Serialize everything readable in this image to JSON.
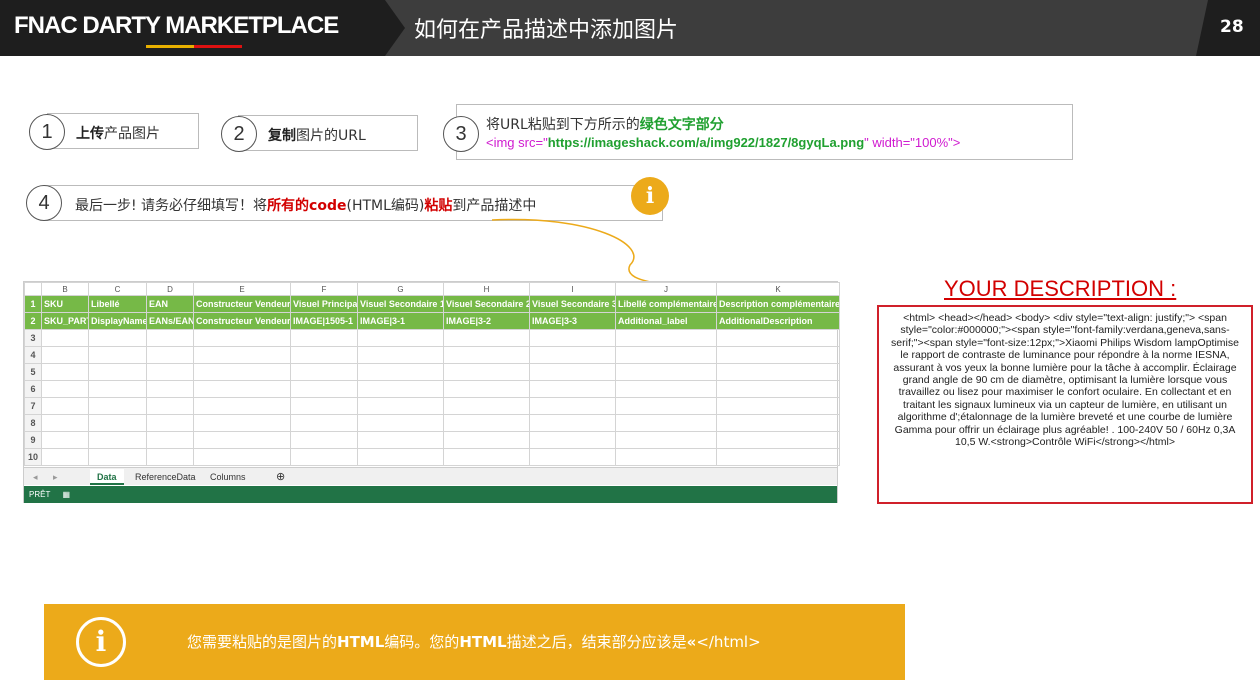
{
  "header": {
    "logo": "FNAC DARTY  MARKETPLACE",
    "title": "如何在产品描述中添加图片",
    "page_number": "28"
  },
  "steps": {
    "s1": {
      "num": "1",
      "bold": "上传",
      "rest": "产品图片"
    },
    "s2": {
      "num": "2",
      "bold": "复制",
      "rest": "图片的URL"
    },
    "s3": {
      "num": "3",
      "line1_a": "将",
      "line1_b": "URL",
      "line1_c": "粘贴到下方所示的",
      "line1_green": "绿色文字部分",
      "code_a": "<img src=\"",
      "code_url": "https://imageshack.com/a/img922/1827/8gyqLa.png",
      "code_b": "\" width=\"100%\">"
    },
    "s4": {
      "num": "4",
      "a": "最后一步! 请务必仔细填写！将",
      "red1": "所有的code",
      "b": "(HTML编码)",
      "red2": "粘贴",
      "c": "到产品描述中"
    }
  },
  "info_icon": "i",
  "sheet": {
    "col_letters": [
      "",
      "B",
      "C",
      "D",
      "E",
      "F",
      "G",
      "H",
      "I",
      "J",
      "K"
    ],
    "row1": [
      "1",
      "SKU",
      "Libellé",
      "EAN",
      "Constructeur Vendeur",
      "Visuel Principal",
      "Visuel Secondaire 1",
      "Visuel Secondaire 2",
      "Visuel Secondaire 3",
      "Libellé complémentaire",
      "Description complémentaire"
    ],
    "row2": [
      "2",
      "SKU_PART",
      "DisplayName",
      "EANs/EAN",
      "Constructeur Vendeur",
      "IMAGE|1505-1",
      "IMAGE|3-1",
      "IMAGE|3-2",
      "IMAGE|3-3",
      "Additional_label",
      "AdditionalDescription"
    ],
    "empty_rows": [
      "3",
      "4",
      "5",
      "6",
      "7",
      "8",
      "9",
      "10"
    ],
    "tabs": [
      "Data",
      "ReferenceData",
      "Columns"
    ],
    "add_tab": "⊕",
    "status": "PRÊT"
  },
  "description": {
    "title": "YOUR DESCRIPTION :",
    "text": "<html> <head></head> <body> <div style=\"text-align: justify;\"> <span style=\"color:#000000;\"><span style=\"font-family:verdana,geneva,sans-serif;\"><span style=\"font-size:12px;\">Xiaomi Philips Wisdom lampOptimise le rapport de contraste de luminance pour répondre à la norme IESNA, assurant à vos yeux la bonne lumière pour la tâche à accomplir. Éclairage grand angle de 90 cm de diamètre, optimisant la lumière lorsque vous travaillez ou lisez pour maximiser le confort oculaire. En collectant et en traitant les signaux lumineux via un capteur de lumière, en utilisant un algorithme d';étalonnage de la lumière breveté et une courbe de lumière Gamma pour offrir un éclairage plus agréable! . 100-240V 50 / 60Hz 0,3A 10,5 W.<strong>Contrôle WiFi</strong></html>"
  },
  "banner": {
    "icon": "i",
    "a": "您需要粘贴的是图片的",
    "b1": "HTML",
    "c": "编码。您的",
    "b2": "HTML",
    "d": "描述之后，结束部分应该是",
    "e": "«",
    "f": "</html>"
  },
  "colors": {
    "header_bg": "#3d3d3d",
    "accent_orange": "#ecaa1a",
    "excel_green": "#76b947",
    "status_green": "#217346",
    "red": "#d20000"
  }
}
